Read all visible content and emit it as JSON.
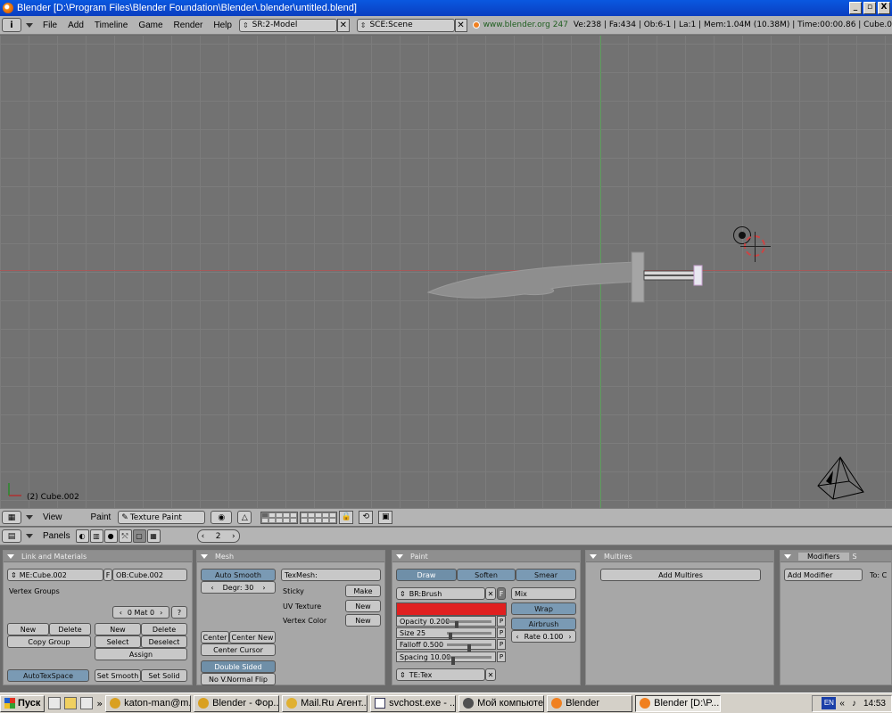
{
  "window": {
    "title": "Blender [D:\\Program Files\\Blender Foundation\\Blender\\.blender\\untitled.blend]",
    "minimize": "_",
    "maximize": "▫",
    "close": "X"
  },
  "menubar": {
    "info_glyph": "i",
    "menus": [
      "File",
      "Add",
      "Timeline",
      "Game",
      "Render",
      "Help"
    ],
    "screen": "SR:2-Model",
    "scene": "SCE:Scene",
    "website": "www.blender.org 247",
    "stats": "Ve:238 | Fa:434 | Ob:6-1 | La:1  | Mem:1.04M (10.38M) | Time:00:00.86 | Cube.0"
  },
  "viewport": {
    "object_label": "(2) Cube.002"
  },
  "viewheader": {
    "view_menu": "View",
    "mode_label": "Paint",
    "mode": "Texture Paint"
  },
  "buttonsheader": {
    "panels_label": "Panels",
    "frame": "2"
  },
  "link_materials": {
    "title": "Link and Materials",
    "mesh_name": "ME:Cube.002",
    "f_label": "F",
    "object_name": "OB:Cube.002",
    "vertex_groups": "Vertex Groups",
    "mat": "0 Mat 0",
    "help": "?",
    "new": "New",
    "delete": "Delete",
    "copy_group": "Copy Group",
    "new2": "New",
    "delete2": "Delete",
    "select": "Select",
    "deselect": "Deselect",
    "assign": "Assign",
    "autotexspace": "AutoTexSpace",
    "set_smooth": "Set Smooth",
    "set_solid": "Set Solid"
  },
  "mesh": {
    "title": "Mesh",
    "auto_smooth": "Auto Smooth",
    "degr": "Degr: 30",
    "texmesh": "TexMesh:",
    "sticky": "Sticky",
    "make": "Make",
    "uv_texture": "UV Texture",
    "uv_new": "New",
    "vertex_color": "Vertex Color",
    "vc_new": "New",
    "center": "Center",
    "center_new": "Center New",
    "center_cursor": "Center Cursor",
    "double_sided": "Double Sided",
    "no_vnormal_flip": "No V.Normal Flip"
  },
  "paint": {
    "title": "Paint",
    "tabs": [
      "Draw",
      "Soften",
      "Smear"
    ],
    "brush": "BR:Brush",
    "f_label": "F",
    "blend": "Mix",
    "color": "#e02020",
    "wrap": "Wrap",
    "airbrush": "Airbrush",
    "rate": "Rate 0.100",
    "opacity": "Opacity 0.200",
    "opacity_value": 0.2,
    "size": "Size 25",
    "size_value": 0.05,
    "falloff": "Falloff 0.500",
    "falloff_value": 0.5,
    "spacing": "Spacing 10.00",
    "spacing_value": 0.1,
    "p_label": "P",
    "texture": "TE:Tex"
  },
  "multires": {
    "title": "Multires",
    "add": "Add Multires"
  },
  "modifiers": {
    "title": "Modifiers",
    "tab2": "S",
    "add": "Add Modifier",
    "to": "To: C"
  },
  "taskbar": {
    "start": "Пуск",
    "more": "»",
    "tasks": [
      {
        "label": "katon-man@m...",
        "color": "#d9a020"
      },
      {
        "label": "Blender - Фор...",
        "color": "#d9a020"
      },
      {
        "label": "Mail.Ru Агент...",
        "color": "#e0b030"
      },
      {
        "label": "svchost.exe - ...",
        "color": "#ffffff"
      },
      {
        "label": "Мой компьютер",
        "color": "#505050"
      },
      {
        "label": "Blender",
        "color": "#f08020"
      },
      {
        "label": "Blender [D:\\P...",
        "color": "#f08020"
      }
    ],
    "lang": "EN",
    "tray_more": "«",
    "clock": "14:53"
  }
}
